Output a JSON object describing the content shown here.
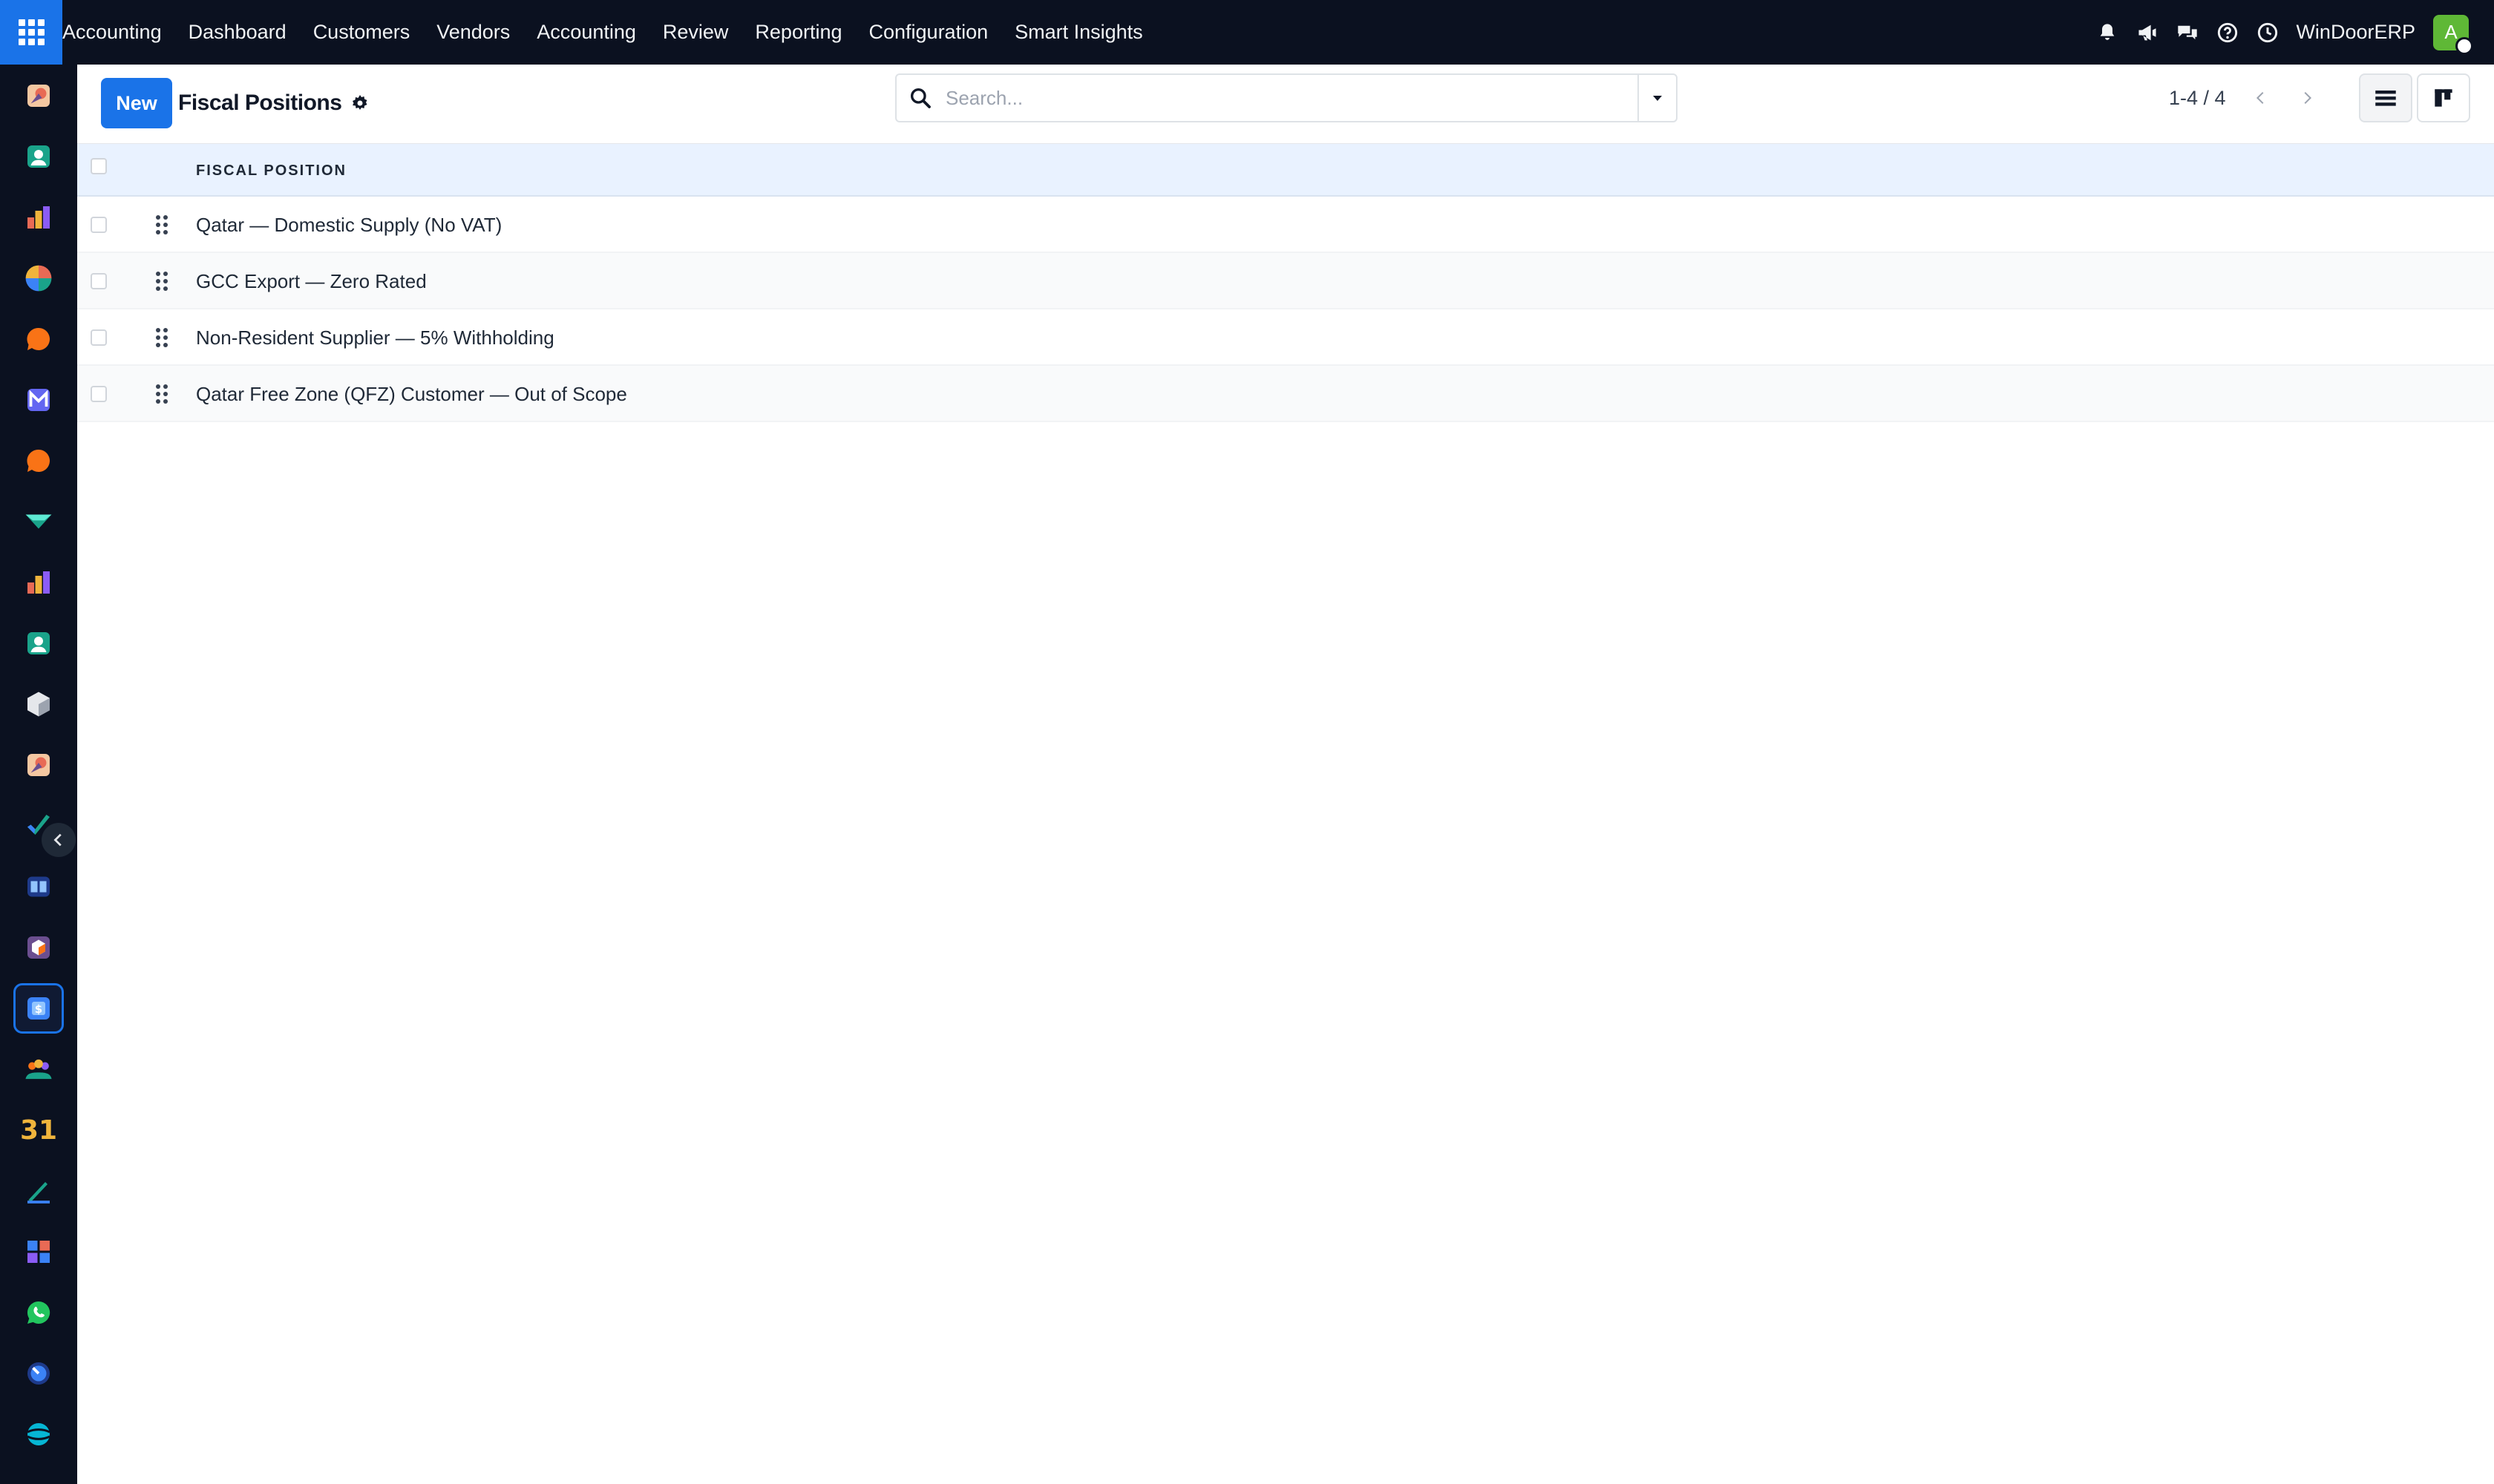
{
  "navbar": {
    "brand": "Accounting",
    "menu": [
      "Dashboard",
      "Customers",
      "Vendors",
      "Accounting",
      "Review",
      "Reporting",
      "Configuration",
      "Smart Insights"
    ],
    "system_icons": [
      "bell-icon",
      "megaphone-icon",
      "chat-icon",
      "help-icon",
      "clock-icon"
    ],
    "company": "WinDoorERP",
    "avatar_initial": "A",
    "avatar_color": "#5fb836"
  },
  "sidebar": {
    "apps": [
      "app-icon",
      "contacts-icon",
      "reporting-icon",
      "pie-chart-icon",
      "discuss-icon",
      "mail-icon",
      "livechat-icon",
      "sign-icon",
      "dashboard-icon",
      "employees-icon",
      "inventory-icon",
      "app-icon",
      "todo-icon",
      "knowledge-icon",
      "package-icon",
      "accounting-icon",
      "team-icon",
      "calendar-icon",
      "sign-pen-icon",
      "spreadsheet-icon",
      "whatsapp-icon",
      "timer-icon",
      "website-icon"
    ],
    "active_index": 15,
    "calendar_day": "31"
  },
  "control_panel": {
    "new_label": "New",
    "title": "Fiscal Positions",
    "search_placeholder": "Search...",
    "pager": "1-4 / 4"
  },
  "table": {
    "column_header": "FISCAL POSITION",
    "rows": [
      "Qatar — Domestic Supply (No VAT)",
      "GCC Export — Zero Rated",
      "Non-Resident Supplier — 5% Withholding",
      "Qatar Free Zone (QFZ) Customer — Out of Scope"
    ]
  },
  "colors": {
    "navbar_bg": "#0b1120",
    "primary": "#1a73e8",
    "header_bg": "#e9f2ff"
  }
}
